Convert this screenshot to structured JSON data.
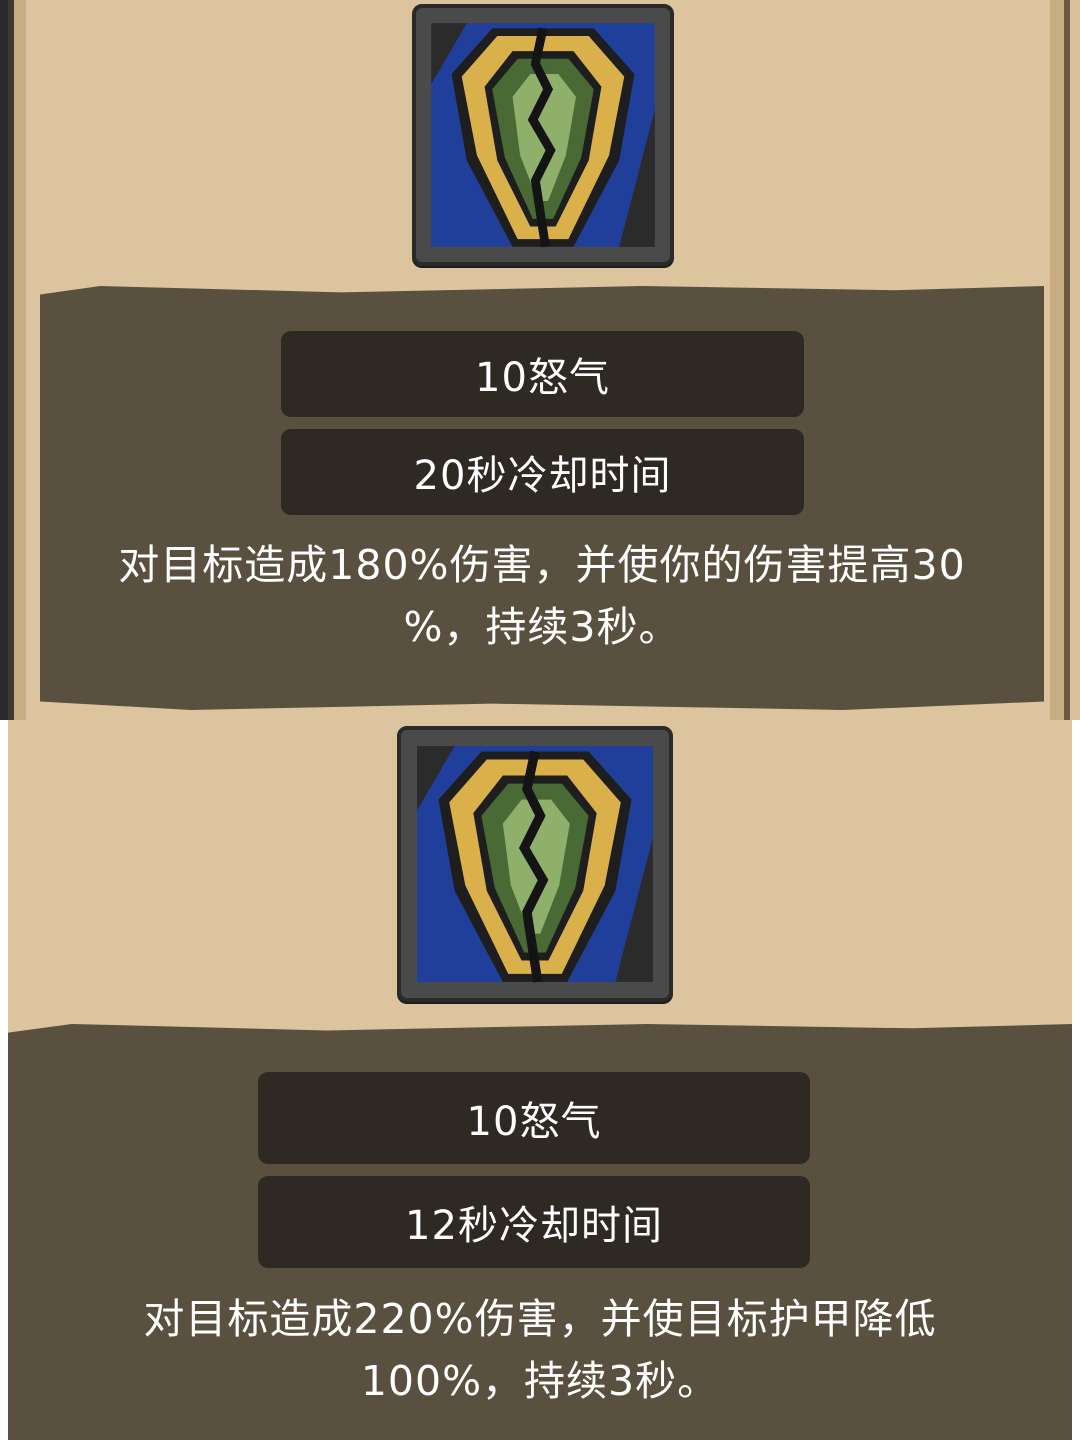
{
  "skills": [
    {
      "icon": "cracked-shield-icon",
      "cost": "10怒气",
      "cooldown": "20秒冷却时间",
      "description_lines": [
        "对目标造成180%伤害，并使你的伤害提高30",
        "%，持续3秒。"
      ]
    },
    {
      "icon": "cracked-shield-icon",
      "cost": "10怒气",
      "cooldown": "12秒冷却时间",
      "description_lines": [
        "对目标造成220%伤害，并使目标护甲降低",
        "100%，持续3秒。"
      ]
    }
  ],
  "colors": {
    "parchment": "#dcc49e",
    "panel": "#5a5040",
    "pill": "#2e2a23",
    "shield_gold": "#d9b04a",
    "shield_green_dark": "#4a6a35",
    "shield_green_light": "#8fb06a",
    "icon_blue": "#1f3f9a"
  }
}
